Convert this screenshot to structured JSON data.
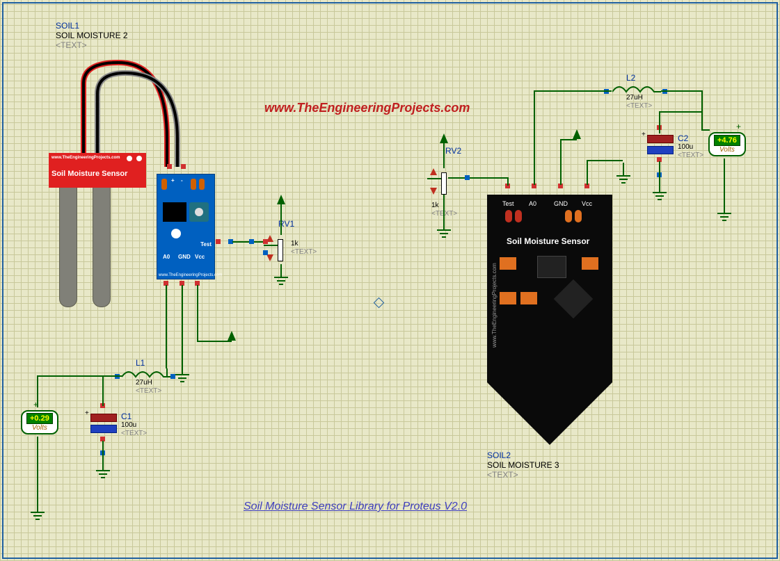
{
  "header": {
    "title": "www.TheEngineeringProjects.com",
    "subtitle": "Soil Moisture Sensor Library for Proteus V2.0"
  },
  "soil1": {
    "ref": "SOIL1",
    "name": "SOIL MOISTURE 2",
    "text": "<TEXT>",
    "sensor_label": "Soil Moisture Sensor",
    "brand": "www.TheEngineeringProjects.com"
  },
  "soil2": {
    "ref": "SOIL2",
    "name": "SOIL MOISTURE 3",
    "text": "<TEXT>",
    "sensor_label": "Soil Moisture Sensor",
    "brand": "www.TheEngineeringProjects.com"
  },
  "bmod": {
    "pins": {
      "a0": "A0",
      "gnd": "GND",
      "vcc": "Vcc",
      "test": "Test",
      "plus": "+",
      "minus": "-"
    },
    "footer": "www.TheEngineeringProjects.com"
  },
  "sbk": {
    "pins": {
      "test": "Test",
      "a0": "A0",
      "gnd": "GND",
      "vcc": "Vcc"
    },
    "title": "Soil Moisture Sensor"
  },
  "rv1": {
    "ref": "RV1",
    "val": "1k",
    "text": "<TEXT>"
  },
  "rv2": {
    "ref": "RV2",
    "val": "1k",
    "text": "<TEXT>"
  },
  "l1": {
    "ref": "L1",
    "val": "27uH",
    "text": "<TEXT>"
  },
  "l2": {
    "ref": "L2",
    "val": "27uH",
    "text": "<TEXT>"
  },
  "c1": {
    "ref": "C1",
    "val": "100u",
    "text": "<TEXT>"
  },
  "c2": {
    "ref": "C2",
    "val": "100u",
    "text": "<TEXT>"
  },
  "probe1": {
    "val": "+0.29",
    "unit": "Volts"
  },
  "probe2": {
    "val": "+4.76",
    "unit": "Volts"
  }
}
